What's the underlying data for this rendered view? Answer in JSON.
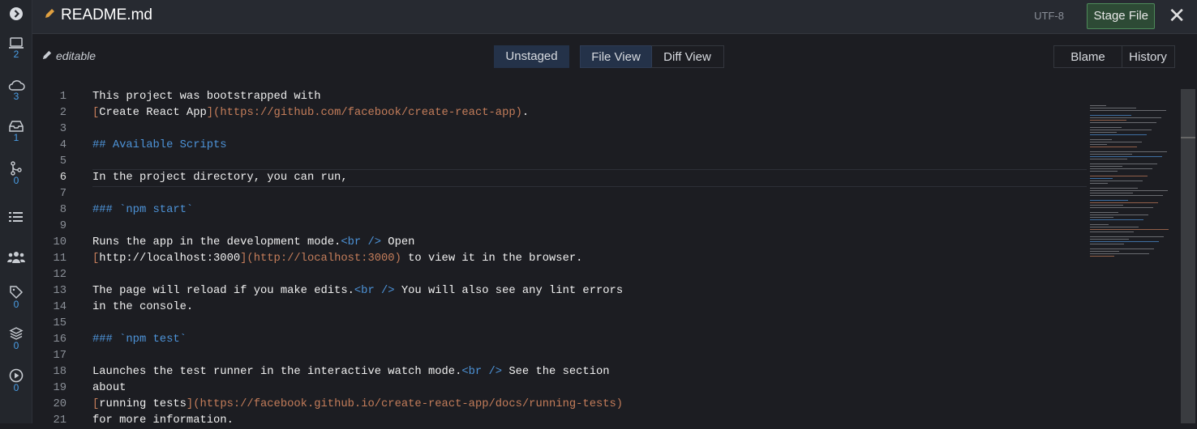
{
  "sidebar": {
    "items": [
      {
        "icon": "chevron-right-circle-icon",
        "count": null
      },
      {
        "icon": "laptop-icon",
        "count": "2"
      },
      {
        "icon": "cloud-icon",
        "count": "3"
      },
      {
        "icon": "inbox-icon",
        "count": "1"
      },
      {
        "icon": "branch-icon",
        "count": "0"
      },
      {
        "icon": "list-icon",
        "count": null
      },
      {
        "icon": "users-icon",
        "count": null
      },
      {
        "icon": "tag-icon",
        "count": "0"
      },
      {
        "icon": "layers-icon",
        "count": "0"
      },
      {
        "icon": "play-circle-icon",
        "count": "0"
      }
    ]
  },
  "header": {
    "title": "README.md",
    "encoding": "UTF-8",
    "stage_label": "Stage File",
    "close": "✕"
  },
  "toolbar": {
    "editable": "editable",
    "unstaged": "Unstaged",
    "file_view": "File View",
    "diff_view": "Diff View",
    "blame": "Blame",
    "history": "History"
  },
  "colors": {
    "accent": "#243249",
    "stage": "#2d4a35",
    "heading": "#4d93d8",
    "link": "#c47d5a"
  },
  "editor": {
    "active_line": 6,
    "lines": [
      [
        [
          "text",
          "This project was bootstrapped with"
        ]
      ],
      [
        [
          "link",
          "["
        ],
        [
          "text",
          "Create React App"
        ],
        [
          "link",
          "](https://github.com/facebook/create-react-app)"
        ],
        [
          "text",
          "."
        ]
      ],
      [],
      [
        [
          "heading",
          "## Available Scripts"
        ]
      ],
      [],
      [
        [
          "text",
          "In the project directory, you can run,"
        ]
      ],
      [],
      [
        [
          "heading",
          "### `npm start`"
        ]
      ],
      [],
      [
        [
          "text",
          "Runs the app in the development mode."
        ],
        [
          "tag",
          "<br />"
        ],
        [
          "text",
          " Open"
        ]
      ],
      [
        [
          "link",
          "["
        ],
        [
          "text",
          "http://localhost:3000"
        ],
        [
          "link",
          "](http://localhost:3000)"
        ],
        [
          "text",
          " to view it in the browser."
        ]
      ],
      [],
      [
        [
          "text",
          "The page will reload if you make edits."
        ],
        [
          "tag",
          "<br />"
        ],
        [
          "text",
          " You will also see any lint errors"
        ]
      ],
      [
        [
          "text",
          "in the console."
        ]
      ],
      [],
      [
        [
          "heading",
          "### `npm test`"
        ]
      ],
      [],
      [
        [
          "text",
          "Launches the test runner in the interactive watch mode."
        ],
        [
          "tag",
          "<br />"
        ],
        [
          "text",
          " See the section"
        ]
      ],
      [
        [
          "text",
          "about"
        ]
      ],
      [
        [
          "link",
          "["
        ],
        [
          "text",
          "running tests"
        ],
        [
          "link",
          "](https://facebook.github.io/create-react-app/docs/running-tests)"
        ]
      ],
      [
        [
          "text",
          "for more information."
        ]
      ]
    ]
  }
}
